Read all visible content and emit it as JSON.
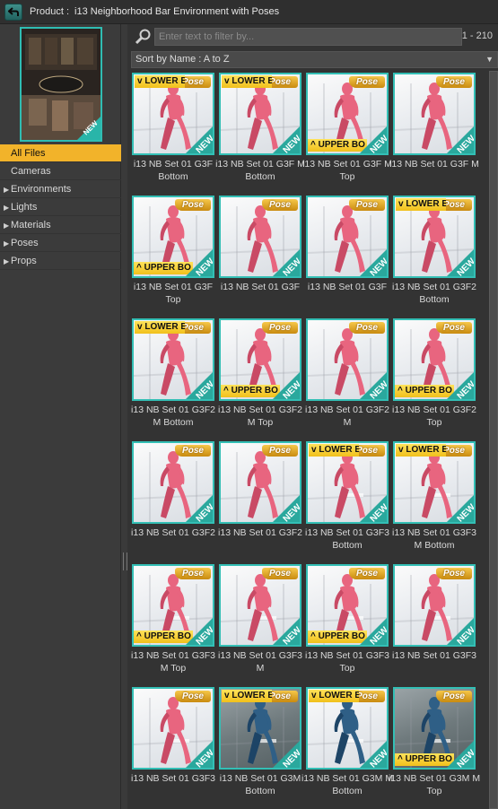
{
  "titlebar": {
    "prefix": "Product :",
    "title": "i13 Neighborhood Bar Environment with Poses",
    "back_icon": "back-arrow-icon"
  },
  "sidebar": {
    "thumb_icon": "product-thumbnail-icon",
    "items": [
      {
        "label": "All Files",
        "selected": true,
        "expandable": false
      },
      {
        "label": "Cameras",
        "selected": false,
        "expandable": false
      },
      {
        "label": "Environments",
        "selected": false,
        "expandable": true
      },
      {
        "label": "Lights",
        "selected": false,
        "expandable": true
      },
      {
        "label": "Materials",
        "selected": false,
        "expandable": true
      },
      {
        "label": "Poses",
        "selected": false,
        "expandable": true
      },
      {
        "label": "Props",
        "selected": false,
        "expandable": true
      }
    ]
  },
  "filter": {
    "placeholder": "Enter text to filter by...",
    "value": "",
    "range": "1 - 210",
    "search_icon": "magnifier-icon"
  },
  "sort": {
    "label": "Sort by Name : A to Z"
  },
  "badges": {
    "pose": "Pose",
    "lower": "v LOWER B",
    "upper": "^ UPPER BO",
    "new": "NEW"
  },
  "tiles": [
    {
      "label": "i13 NB Set 01 G3F Bottom",
      "badge": "lower",
      "tone": "light",
      "figure": "pink"
    },
    {
      "label": "i13 NB Set 01 G3F M Bottom",
      "badge": "lower",
      "tone": "light",
      "figure": "pink"
    },
    {
      "label": "i13 NB Set 01 G3F M Top",
      "badge": "upper",
      "tone": "light",
      "figure": "pink"
    },
    {
      "label": "i13 NB Set 01 G3F M",
      "badge": "none",
      "tone": "light",
      "figure": "pink"
    },
    {
      "label": "i13 NB Set 01 G3F Top",
      "badge": "upper",
      "tone": "light",
      "figure": "pink"
    },
    {
      "label": "i13 NB Set 01 G3F",
      "badge": "none",
      "tone": "light",
      "figure": "pink"
    },
    {
      "label": "i13 NB Set 01 G3F",
      "badge": "none",
      "tone": "light",
      "figure": "pink"
    },
    {
      "label": "i13 NB Set 01 G3F2 Bottom",
      "badge": "lower",
      "tone": "light",
      "figure": "pink"
    },
    {
      "label": "i13 NB Set 01 G3F2 M Bottom",
      "badge": "lower",
      "tone": "light",
      "figure": "pink"
    },
    {
      "label": "i13 NB Set 01 G3F2 M Top",
      "badge": "upper",
      "tone": "light",
      "figure": "pink"
    },
    {
      "label": "i13 NB Set 01 G3F2 M",
      "badge": "none",
      "tone": "light",
      "figure": "pink"
    },
    {
      "label": "i13 NB Set 01 G3F2 Top",
      "badge": "upper",
      "tone": "light",
      "figure": "pink"
    },
    {
      "label": "i13 NB Set 01 G3F2",
      "badge": "none",
      "tone": "light",
      "figure": "pink"
    },
    {
      "label": "i13 NB Set 01 G3F2",
      "badge": "none",
      "tone": "light",
      "figure": "pink"
    },
    {
      "label": "i13 NB Set 01 G3F3 Bottom",
      "badge": "lower",
      "tone": "light",
      "figure": "pink"
    },
    {
      "label": "i13 NB Set 01 G3F3 M Bottom",
      "badge": "lower",
      "tone": "light",
      "figure": "pink"
    },
    {
      "label": "i13 NB Set 01 G3F3 M Top",
      "badge": "upper",
      "tone": "light",
      "figure": "pink"
    },
    {
      "label": "i13 NB Set 01 G3F3 M",
      "badge": "none",
      "tone": "light",
      "figure": "pink"
    },
    {
      "label": "i13 NB Set 01 G3F3 Top",
      "badge": "upper",
      "tone": "light",
      "figure": "pink"
    },
    {
      "label": "i13 NB Set 01 G3F3",
      "badge": "none",
      "tone": "light",
      "figure": "pink"
    },
    {
      "label": "i13 NB Set 01 G3F3",
      "badge": "none",
      "tone": "light",
      "figure": "pink"
    },
    {
      "label": "i13 NB Set 01 G3M Bottom",
      "badge": "lower",
      "tone": "dark",
      "figure": "blue"
    },
    {
      "label": "i13 NB Set 01 G3M M Bottom",
      "badge": "lower",
      "tone": "light",
      "figure": "blue"
    },
    {
      "label": "i13 NB Set 01 G3M M Top",
      "badge": "upper",
      "tone": "dark",
      "figure": "blue"
    }
  ],
  "colors": {
    "accent": "#f2b32a",
    "tile_border": "#33bfb5",
    "pink_figure": "#e8657f",
    "blue_figure": "#2f5f86"
  }
}
